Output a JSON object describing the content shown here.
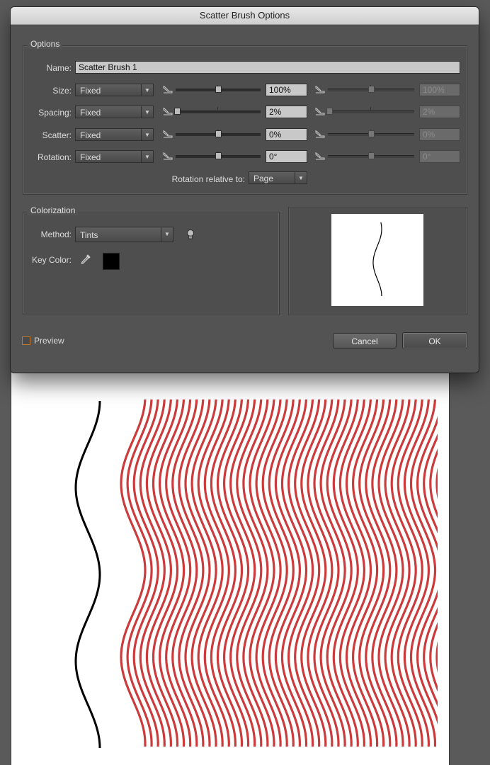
{
  "dialog": {
    "title": "Scatter Brush Options"
  },
  "options": {
    "legend": "Options",
    "name_label": "Name:",
    "name_value": "Scatter Brush 1",
    "rows": [
      {
        "key": "size",
        "label": "Size:",
        "mode": "Fixed",
        "value": "100%",
        "max_value": "100%",
        "slider_position": 0.5
      },
      {
        "key": "spacing",
        "label": "Spacing:",
        "mode": "Fixed",
        "value": "2%",
        "max_value": "2%",
        "slider_position": 0.02
      },
      {
        "key": "scatter",
        "label": "Scatter:",
        "mode": "Fixed",
        "value": "0%",
        "max_value": "0%",
        "slider_position": 0.5
      },
      {
        "key": "rotation",
        "label": "Rotation:",
        "mode": "Fixed",
        "value": "0°",
        "max_value": "0°",
        "slider_position": 0.5
      }
    ],
    "rotation_relative_label": "Rotation relative to:",
    "rotation_relative_value": "Page"
  },
  "colorization": {
    "legend": "Colorization",
    "method_label": "Method:",
    "method_value": "Tints",
    "key_color_label": "Key Color:",
    "key_color": "#000000"
  },
  "footer": {
    "preview_label": "Preview",
    "preview_checked": false,
    "cancel_label": "Cancel",
    "ok_label": "OK"
  },
  "artwork": {
    "stroke_color": "#000000",
    "pattern_color": "#cc3b3b"
  },
  "icons": {
    "eyedropper": "eyedropper-icon",
    "tip": "lightbulb-icon",
    "dropdown": "chevron-down-icon"
  }
}
